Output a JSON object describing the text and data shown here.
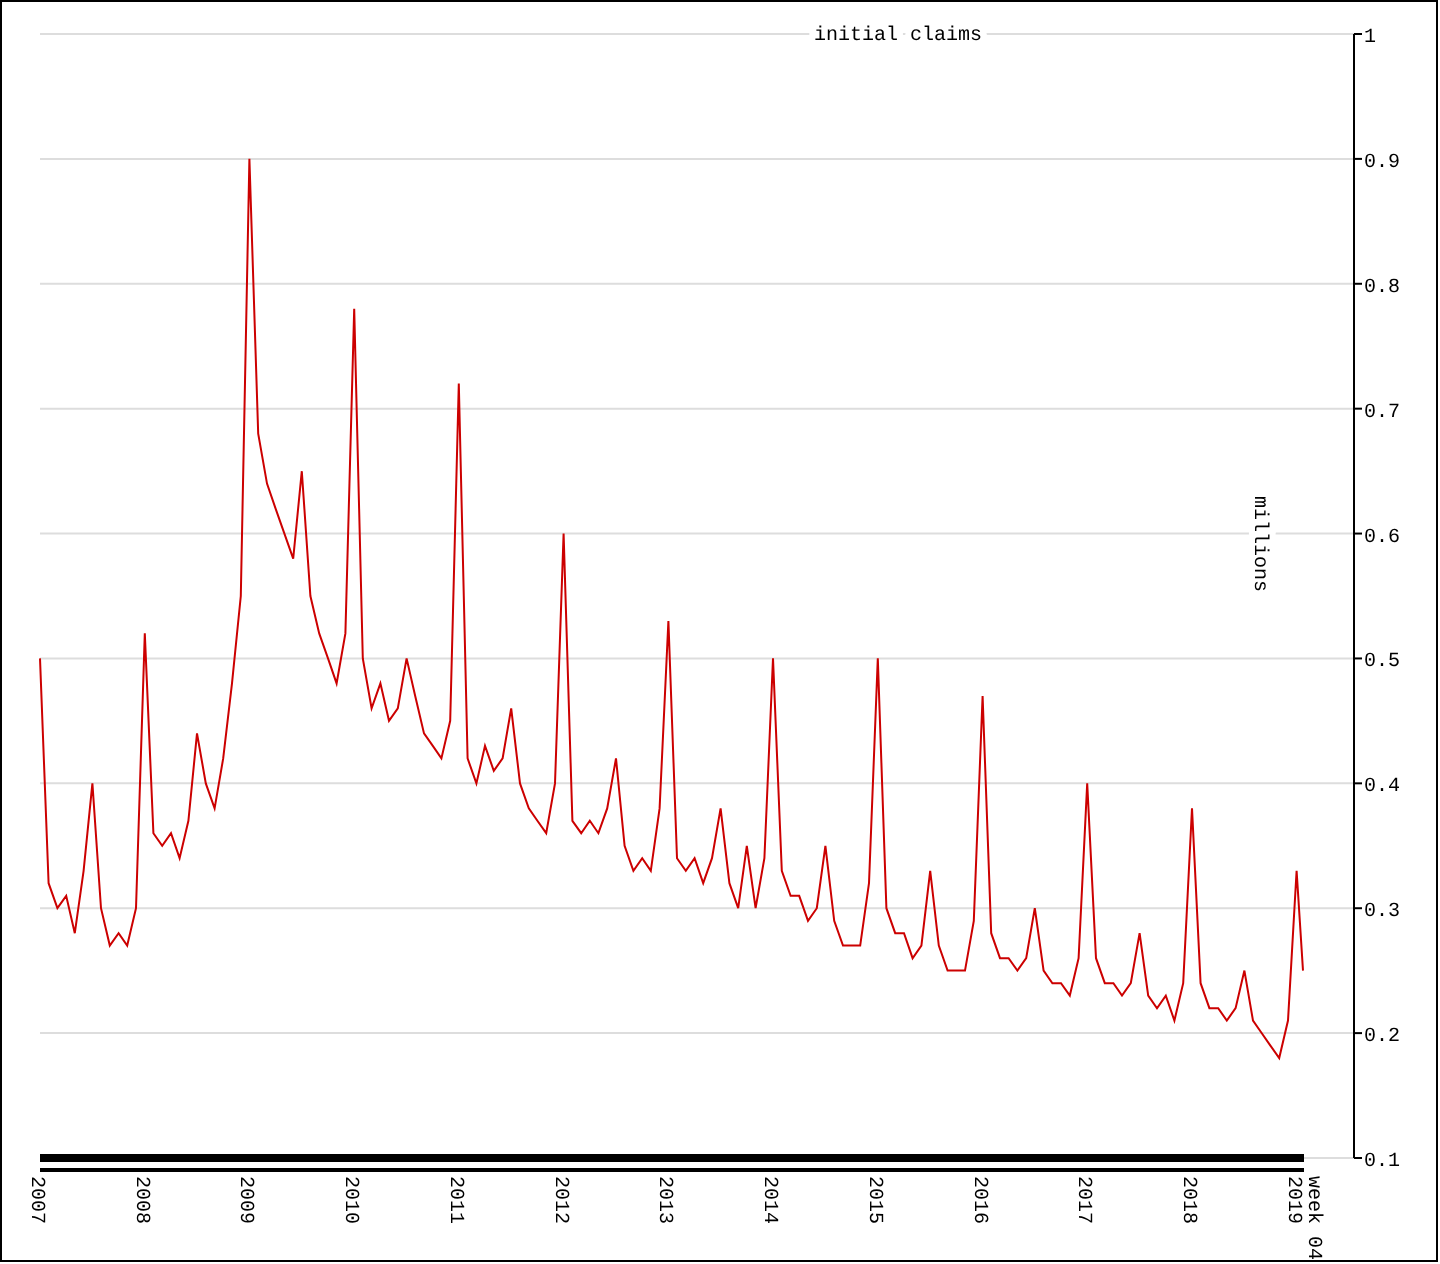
{
  "chart": {
    "chart_data": {
      "type": "line",
      "title": "initial claims",
      "ylabel": "millions",
      "xlim": [
        2007,
        2019.07
      ],
      "ylim": [
        0.1,
        1
      ],
      "yticks": [
        0.1,
        0.2,
        0.3,
        0.4,
        0.5,
        0.6,
        0.7,
        0.8,
        0.9,
        1
      ],
      "xticks": [
        {
          "value": 2007,
          "label": "2007"
        },
        {
          "value": 2008,
          "label": "2008"
        },
        {
          "value": 2009,
          "label": "2009"
        },
        {
          "value": 2010,
          "label": "2010"
        },
        {
          "value": 2011,
          "label": "2011"
        },
        {
          "value": 2012,
          "label": "2012"
        },
        {
          "value": 2013,
          "label": "2013"
        },
        {
          "value": 2014,
          "label": "2014"
        },
        {
          "value": 2015,
          "label": "2015"
        },
        {
          "value": 2016,
          "label": "2016"
        },
        {
          "value": 2017,
          "label": "2017"
        },
        {
          "value": 2018,
          "label": "2018"
        },
        {
          "value": 2019,
          "label": "2019"
        }
      ],
      "annotations": [
        "week 04"
      ],
      "grid": true,
      "x": [
        2007,
        2007.083,
        2007.167,
        2007.25,
        2007.333,
        2007.417,
        2007.5,
        2007.583,
        2007.667,
        2007.75,
        2007.833,
        2007.917,
        2008,
        2008.083,
        2008.167,
        2008.25,
        2008.333,
        2008.417,
        2008.5,
        2008.583,
        2008.667,
        2008.75,
        2008.833,
        2008.917,
        2009,
        2009.083,
        2009.167,
        2009.25,
        2009.333,
        2009.417,
        2009.5,
        2009.583,
        2009.667,
        2009.75,
        2009.833,
        2009.917,
        2010,
        2010.083,
        2010.167,
        2010.25,
        2010.333,
        2010.417,
        2010.5,
        2010.583,
        2010.667,
        2010.75,
        2010.833,
        2010.917,
        2011,
        2011.083,
        2011.167,
        2011.25,
        2011.333,
        2011.417,
        2011.5,
        2011.583,
        2011.667,
        2011.75,
        2011.833,
        2011.917,
        2012,
        2012.083,
        2012.167,
        2012.25,
        2012.333,
        2012.417,
        2012.5,
        2012.583,
        2012.667,
        2012.75,
        2012.833,
        2012.917,
        2013,
        2013.083,
        2013.167,
        2013.25,
        2013.333,
        2013.417,
        2013.5,
        2013.583,
        2013.667,
        2013.75,
        2013.833,
        2013.917,
        2014,
        2014.083,
        2014.167,
        2014.25,
        2014.333,
        2014.417,
        2014.5,
        2014.583,
        2014.667,
        2014.75,
        2014.833,
        2014.917,
        2015,
        2015.083,
        2015.167,
        2015.25,
        2015.333,
        2015.417,
        2015.5,
        2015.583,
        2015.667,
        2015.75,
        2015.833,
        2015.917,
        2016,
        2016.083,
        2016.167,
        2016.25,
        2016.333,
        2016.417,
        2016.5,
        2016.583,
        2016.667,
        2016.75,
        2016.833,
        2016.917,
        2017,
        2017.083,
        2017.167,
        2017.25,
        2017.333,
        2017.417,
        2017.5,
        2017.583,
        2017.667,
        2017.75,
        2017.833,
        2017.917,
        2018,
        2018.083,
        2018.167,
        2018.25,
        2018.333,
        2018.417,
        2018.5,
        2018.583,
        2018.667,
        2018.75,
        2018.833,
        2018.917,
        2019,
        2019.06
      ],
      "series": [
        {
          "color": "#cc0000",
          "values": [
            0.5,
            0.32,
            0.3,
            0.31,
            0.28,
            0.33,
            0.4,
            0.3,
            0.27,
            0.28,
            0.27,
            0.3,
            0.52,
            0.36,
            0.35,
            0.36,
            0.34,
            0.37,
            0.44,
            0.4,
            0.38,
            0.42,
            0.48,
            0.55,
            0.9,
            0.68,
            0.64,
            0.62,
            0.6,
            0.58,
            0.65,
            0.55,
            0.52,
            0.5,
            0.48,
            0.52,
            0.78,
            0.5,
            0.46,
            0.48,
            0.45,
            0.46,
            0.5,
            0.47,
            0.44,
            0.43,
            0.42,
            0.45,
            0.72,
            0.42,
            0.4,
            0.43,
            0.41,
            0.42,
            0.46,
            0.4,
            0.38,
            0.37,
            0.36,
            0.4,
            0.6,
            0.37,
            0.36,
            0.37,
            0.36,
            0.38,
            0.42,
            0.35,
            0.33,
            0.34,
            0.33,
            0.38,
            0.53,
            0.34,
            0.33,
            0.34,
            0.32,
            0.34,
            0.38,
            0.32,
            0.3,
            0.35,
            0.3,
            0.34,
            0.5,
            0.33,
            0.31,
            0.31,
            0.29,
            0.3,
            0.35,
            0.29,
            0.27,
            0.27,
            0.27,
            0.32,
            0.5,
            0.3,
            0.28,
            0.28,
            0.26,
            0.27,
            0.33,
            0.27,
            0.25,
            0.25,
            0.25,
            0.29,
            0.47,
            0.28,
            0.26,
            0.26,
            0.25,
            0.26,
            0.3,
            0.25,
            0.24,
            0.24,
            0.23,
            0.26,
            0.4,
            0.26,
            0.24,
            0.24,
            0.23,
            0.24,
            0.28,
            0.23,
            0.22,
            0.23,
            0.21,
            0.24,
            0.38,
            0.24,
            0.22,
            0.22,
            0.21,
            0.22,
            0.25,
            0.21,
            0.2,
            0.19,
            0.18,
            0.21,
            0.33,
            0.25
          ]
        }
      ]
    }
  }
}
